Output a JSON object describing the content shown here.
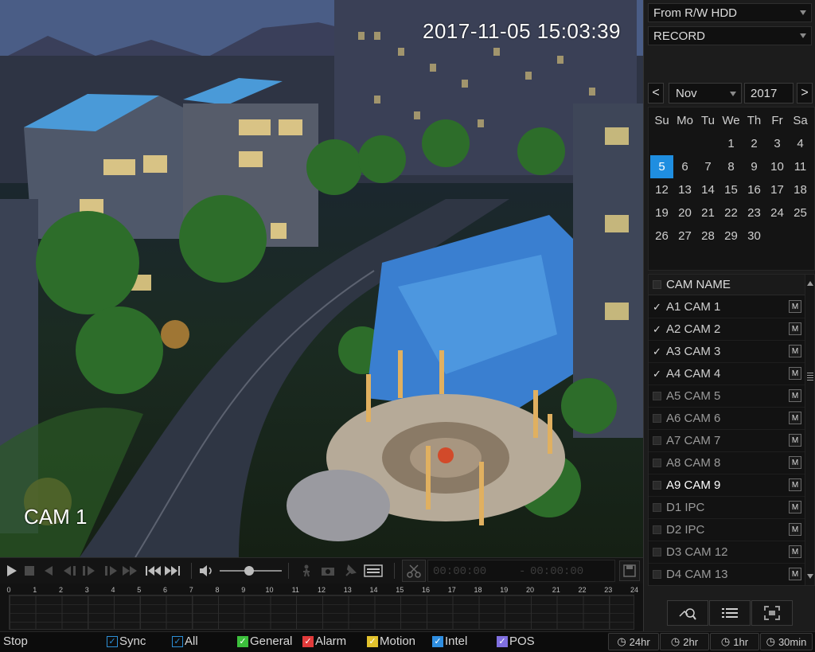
{
  "video": {
    "timestamp": "2017-11-05 15:03:39",
    "channel_label": "CAM 1"
  },
  "toolbar": {
    "icons": [
      "play-icon",
      "stop-icon",
      "reverse-play-icon",
      "prev-frame-icon",
      "next-frame-icon",
      "fast-forward-icon",
      "prev-next-record-icon",
      "volume-icon",
      "smart-search-icon",
      "snapshot-icon",
      "mark-icon",
      "tag-list-icon",
      "clip-icon",
      "save-icon"
    ],
    "clip_start": "00:00:00",
    "clip_dash": "-",
    "clip_end": "00:00:00",
    "volume_level": 0.5
  },
  "timeline": {
    "hours": [
      "0",
      "1",
      "2",
      "3",
      "4",
      "5",
      "6",
      "7",
      "8",
      "9",
      "10",
      "11",
      "12",
      "13",
      "14",
      "15",
      "16",
      "17",
      "18",
      "19",
      "20",
      "21",
      "22",
      "23",
      "24"
    ]
  },
  "status": {
    "state": "Stop",
    "sync_label": "Sync",
    "all_label": "All",
    "legend": [
      {
        "label": "General",
        "color": "#3cc03c"
      },
      {
        "label": "Alarm",
        "color": "#e23b3b"
      },
      {
        "label": "Motion",
        "color": "#e2c22d"
      },
      {
        "label": "Intel",
        "color": "#2f8ee0"
      },
      {
        "label": "POS",
        "color": "#7f6fe0"
      }
    ],
    "ranges": [
      "24hr",
      "2hr",
      "1hr",
      "30min"
    ]
  },
  "panel": {
    "source": "From R/W HDD",
    "record_type": "RECORD",
    "calendar": {
      "prev": "<",
      "next": ">",
      "month": "Nov",
      "year": "2017",
      "weekdays": [
        "Su",
        "Mo",
        "Tu",
        "We",
        "Th",
        "Fr",
        "Sa"
      ],
      "days": [
        "1",
        "2",
        "3",
        "4",
        "5",
        "6",
        "7",
        "8",
        "9",
        "10",
        "11",
        "12",
        "13",
        "14",
        "15",
        "16",
        "17",
        "18",
        "19",
        "20",
        "21",
        "22",
        "23",
        "24",
        "25",
        "26",
        "27",
        "28",
        "29",
        "30"
      ],
      "first_weekday": 3,
      "selected_day": "5"
    },
    "cam_header": "CAM NAME",
    "cameras": [
      {
        "name": "A1 CAM 1",
        "checked": true
      },
      {
        "name": "A2 CAM 2",
        "checked": true
      },
      {
        "name": "A3 CAM 3",
        "checked": true
      },
      {
        "name": "A4 CAM 4",
        "checked": true
      },
      {
        "name": "A5 CAM 5",
        "checked": false
      },
      {
        "name": "A6 CAM 6",
        "checked": false
      },
      {
        "name": "A7 CAM 7",
        "checked": false
      },
      {
        "name": "A8 CAM 8",
        "checked": false
      },
      {
        "name": "A9 CAM 9",
        "checked": false
      },
      {
        "name": "D1 IPC",
        "checked": false
      },
      {
        "name": "D2 IPC",
        "checked": false
      },
      {
        "name": "D3 CAM 12",
        "checked": false
      },
      {
        "name": "D4 CAM 13",
        "checked": false
      }
    ],
    "m_label": "M",
    "bottom_buttons": [
      "smart-search-icon",
      "list-icon",
      "fullscreen-icon"
    ]
  }
}
